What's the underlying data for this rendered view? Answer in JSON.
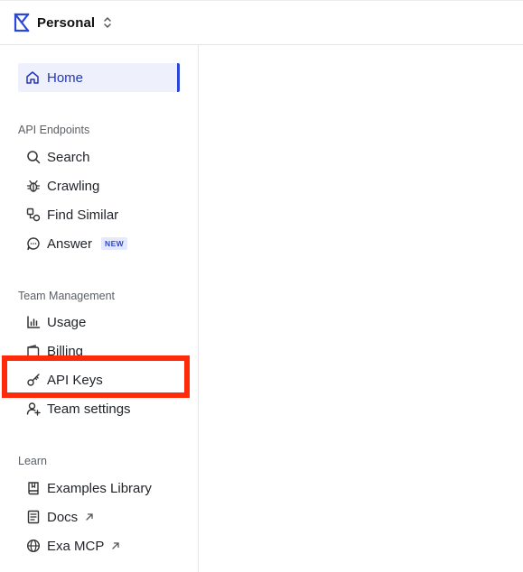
{
  "header": {
    "workspace": "Personal"
  },
  "sidebar": {
    "home": {
      "label": "Home"
    },
    "sections": {
      "api": {
        "title": "API Endpoints",
        "items": [
          {
            "label": "Search",
            "icon": "search-icon"
          },
          {
            "label": "Crawling",
            "icon": "bug-icon"
          },
          {
            "label": "Find Similar",
            "icon": "similar-icon"
          },
          {
            "label": "Answer",
            "icon": "chat-bubble-icon",
            "badge": "NEW"
          }
        ]
      },
      "team": {
        "title": "Team Management",
        "items": [
          {
            "label": "Usage",
            "icon": "bar-chart-icon"
          },
          {
            "label": "Billing",
            "icon": "wallet-icon"
          },
          {
            "label": "API Keys",
            "icon": "key-icon"
          },
          {
            "label": "Team settings",
            "icon": "user-plus-icon"
          }
        ]
      },
      "learn": {
        "title": "Learn",
        "items": [
          {
            "label": "Examples Library",
            "icon": "book-icon"
          },
          {
            "label": "Docs",
            "icon": "document-icon"
          },
          {
            "label": "Exa MCP",
            "icon": "globe-icon"
          }
        ]
      }
    }
  },
  "colors": {
    "accent": "#2b47d9",
    "highlight": "#ff2a0a",
    "home_bg": "#eef0fb"
  }
}
